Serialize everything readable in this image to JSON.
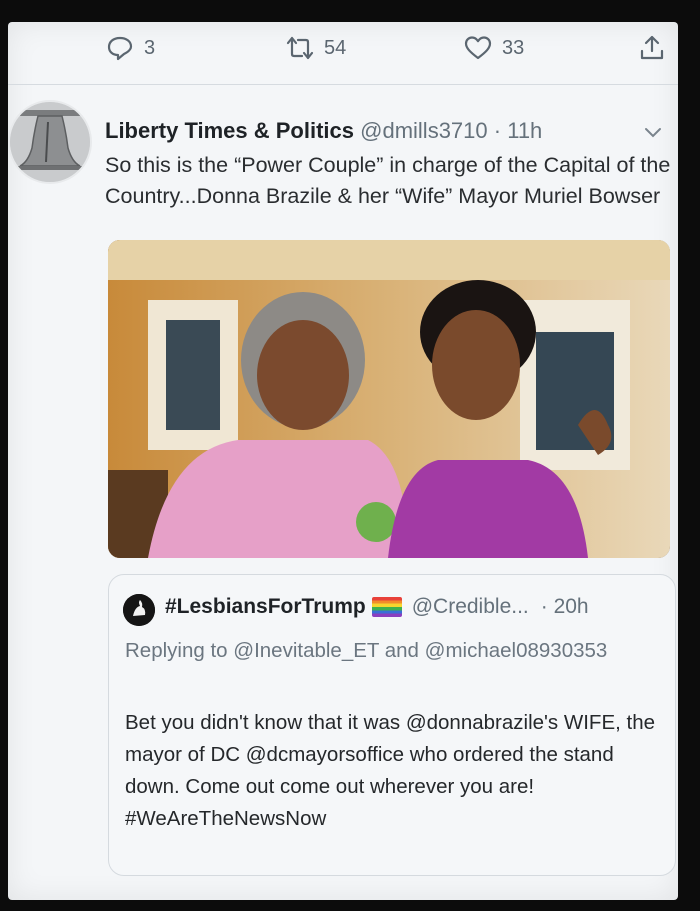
{
  "actions": {
    "reply_count": "3",
    "retweet_count": "54",
    "like_count": "33"
  },
  "tweet": {
    "name": "Liberty Times & Politics",
    "handle": "@dmills3710",
    "separator": "·",
    "time": "11h",
    "text": "So this is the “Power Couple” in charge of the Capital of the Country...Donna Brazile & her “Wife” Mayor Muriel Bowser",
    "avatar_icon": "liberty-bell-icon"
  },
  "quote": {
    "name": "#LesbiansForTrump",
    "flag_icon": "rainbow-flag-icon",
    "handle": "@Credible...",
    "time": "· 20h",
    "reply_line": "Replying to @Inevitable_ET and @michael08930353",
    "text": "Bet you didn't know that it was @donnabrazile's WIFE, the mayor of DC @dcmayorsoffice who ordered the stand down. Come out come out wherever you are! #WeAreTheNewsNow"
  },
  "colors": {
    "background": "#f4f6f8",
    "secondary_text": "#65717b",
    "primary_text": "#1e2226",
    "rainbow": [
      "#e8413a",
      "#f28c2b",
      "#f6d62e",
      "#3fb04f",
      "#3a6fd6",
      "#8a3fbf"
    ]
  }
}
